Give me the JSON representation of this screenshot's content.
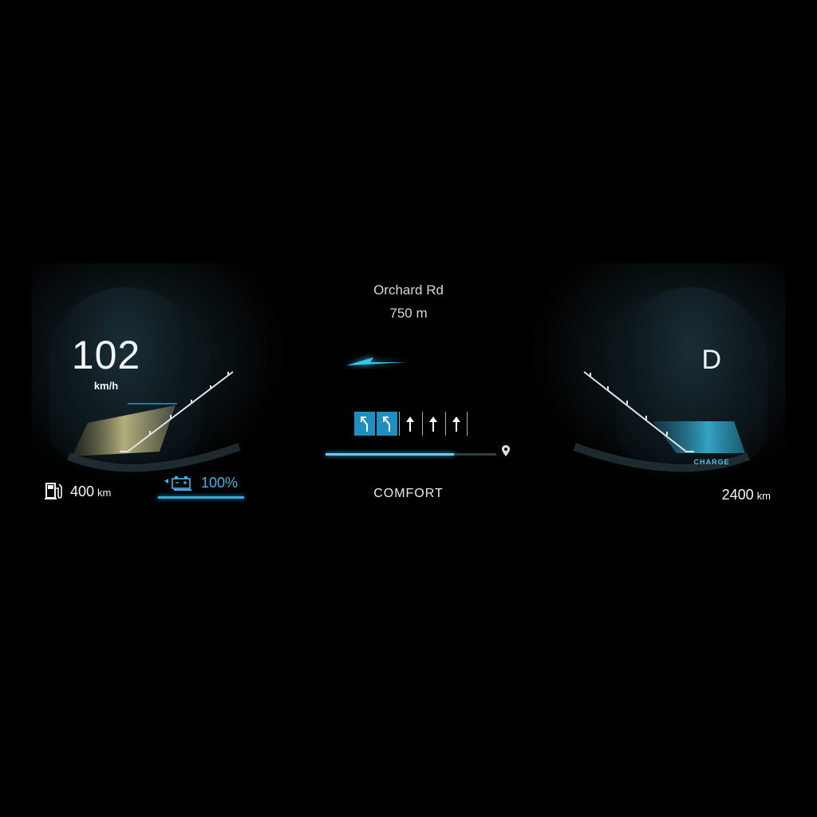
{
  "navigation": {
    "street": "Orchard Rd",
    "distance": "750 m",
    "route_progress": 0.75,
    "lanes": [
      {
        "direction": "left",
        "active": true
      },
      {
        "direction": "left",
        "active": true
      },
      {
        "direction": "straight",
        "active": false
      },
      {
        "direction": "straight",
        "active": false
      },
      {
        "direction": "straight",
        "active": false
      }
    ]
  },
  "speedometer": {
    "speed": "102",
    "unit": "km/h"
  },
  "gear": "D",
  "drive_mode": "COMFORT",
  "range_left": {
    "value": "400",
    "unit": "km",
    "icon": "fuel-pump-icon"
  },
  "battery": {
    "percent": "100%",
    "icon": "battery-icon"
  },
  "range_right": {
    "value": "2400",
    "unit": "km"
  },
  "charge_label": "CHARGE",
  "colors": {
    "accent": "#3fb6e8",
    "power": "#d8cf8a",
    "background": "#000000"
  }
}
